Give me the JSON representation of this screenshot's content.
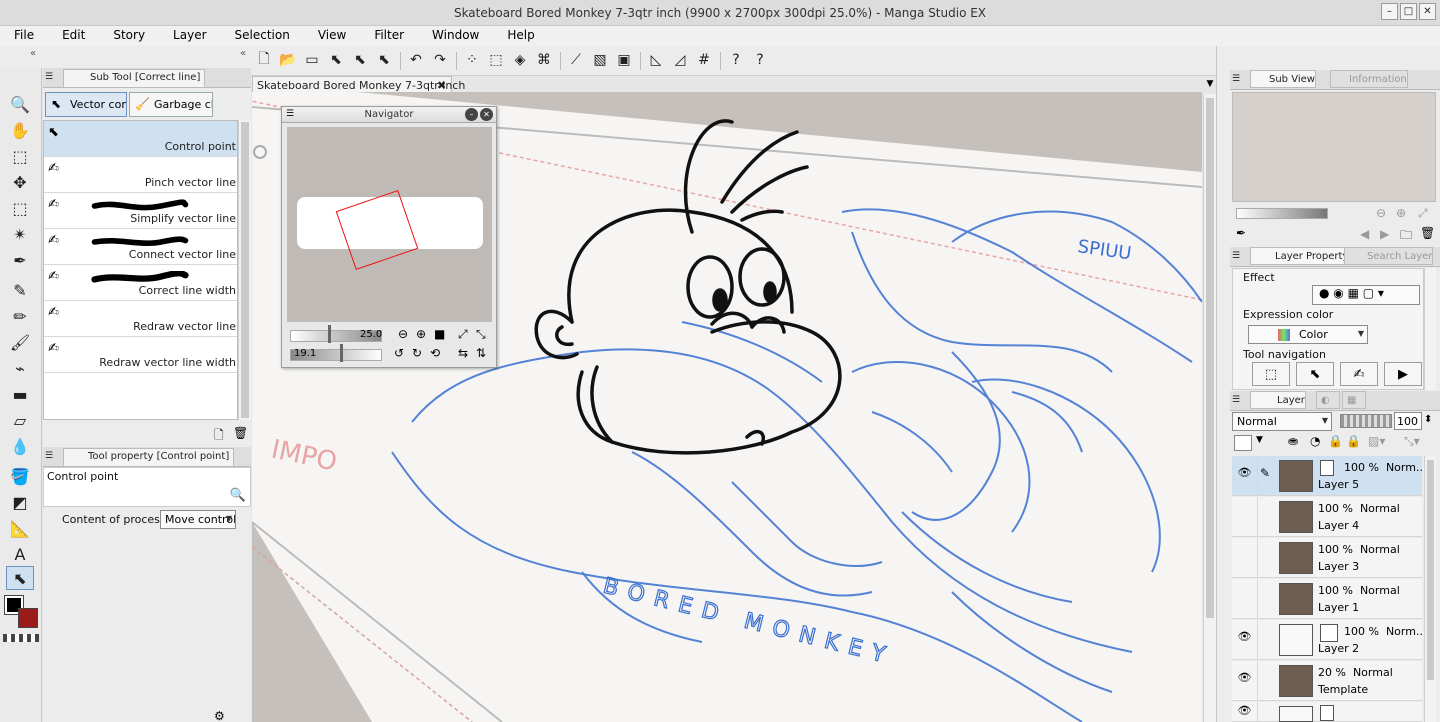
{
  "window": {
    "title": "Skateboard Bored Monkey 7-3qtr inch (9900 x 2700px 300dpi 25.0%) - Manga Studio EX"
  },
  "menu": [
    "File",
    "Edit",
    "Story",
    "Layer",
    "Selection",
    "View",
    "Filter",
    "Window",
    "Help"
  ],
  "sub_tool": {
    "title": "Sub Tool [Correct line]",
    "tabs": [
      "Vector control",
      "Garbage clear"
    ],
    "items": [
      "Control point",
      "Pinch vector line",
      "Simplify vector line",
      "Connect vector line",
      "Correct line width",
      "Redraw vector line",
      "Redraw vector line width"
    ]
  },
  "tool_property": {
    "title": "Tool property [Control point]",
    "tool_name": "Control point",
    "content_label": "Content of process",
    "content_value": "Move control point"
  },
  "document_tab": "Skateboard Bored Monkey 7-3qtr inch",
  "navigator": {
    "title": "Navigator",
    "zoom": "25.0",
    "rotation": "19.1"
  },
  "canvas_text": {
    "impo": "IMPO",
    "spiuu": "SPIUU",
    "bored_monkey": "BORED MONKEY"
  },
  "sub_view": {
    "tabs": [
      "Sub View",
      "Information"
    ]
  },
  "layer_property": {
    "tabs": [
      "Layer Property",
      "Search Layer"
    ],
    "effect_label": "Effect",
    "expression_label": "Expression color",
    "expression_value": "Color",
    "tool_nav_label": "Tool navigation"
  },
  "layer_panel": {
    "tab": "Layer",
    "blend": "Normal",
    "opacity": "100",
    "layers": [
      {
        "opacity": "100 %",
        "mode": "Norm...",
        "name": "Layer 5",
        "visible": true,
        "selected": true,
        "light": false
      },
      {
        "opacity": "100 %",
        "mode": "Normal",
        "name": "Layer 4",
        "visible": false,
        "selected": false,
        "light": false
      },
      {
        "opacity": "100 %",
        "mode": "Normal",
        "name": "Layer 3",
        "visible": false,
        "selected": false,
        "light": false
      },
      {
        "opacity": "100 %",
        "mode": "Normal",
        "name": "Layer 1",
        "visible": false,
        "selected": false,
        "light": false
      },
      {
        "opacity": "100 %",
        "mode": "Norm...",
        "name": "Layer 2",
        "visible": true,
        "selected": false,
        "light": true
      },
      {
        "opacity": "20 %",
        "mode": "Normal",
        "name": "Template",
        "visible": true,
        "selected": false,
        "light": false
      }
    ]
  },
  "colors": {
    "main": "#000000",
    "sub": "#9b1b1b",
    "accent": "#6b93bd",
    "sketch_blue": "#3a6fd0"
  }
}
